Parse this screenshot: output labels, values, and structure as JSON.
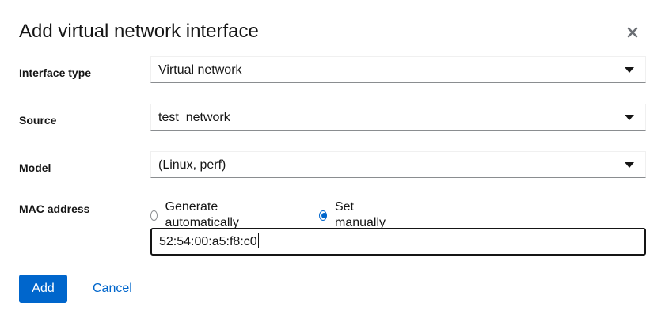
{
  "dialog": {
    "title": "Add virtual network interface",
    "close_icon": "close-icon"
  },
  "fields": {
    "interface_type": {
      "label": "Interface type",
      "value": "Virtual network"
    },
    "source": {
      "label": "Source",
      "value": "test_network"
    },
    "model": {
      "label": "Model",
      "value": "(Linux, perf)"
    },
    "mac_address": {
      "label": "MAC address",
      "options": [
        {
          "label": "Generate automatically",
          "checked": false
        },
        {
          "label": "Set manually",
          "checked": true
        }
      ],
      "value": "52:54:00:a5:f8:c0"
    }
  },
  "footer": {
    "add_label": "Add",
    "cancel_label": "Cancel"
  },
  "colors": {
    "primary": "#0066cc",
    "text": "#151515",
    "border": "#8a8d90"
  }
}
